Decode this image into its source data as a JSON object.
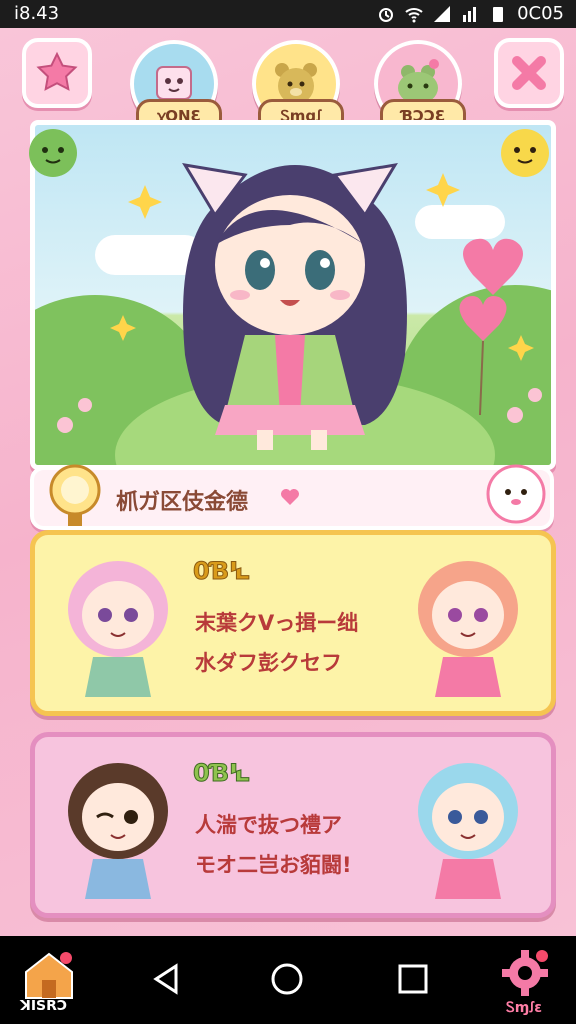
{
  "status_bar": {
    "time": "i8.43",
    "battery_text": "0C05"
  },
  "top_tabs": [
    {
      "label": "ꭓOƝƐ"
    },
    {
      "label": "Ꮪɱɑꭍ"
    },
    {
      "label": "ƁƆƆƐ"
    }
  ],
  "banner": {
    "text": "枛ガ区伎金德"
  },
  "cards": [
    {
      "tag": "0ƁꝆ",
      "line1": "末葉クVっ揖ー绌",
      "line2": "水ダフ彭クセフ"
    },
    {
      "tag": "0ƁꝆ",
      "line1": "人湍で抜つ禮ア",
      "line2": "モオ二岂お貊闘!"
    }
  ],
  "bottom_nav": {
    "home_label": "ꓘꓲꓢꓣꓛ",
    "settings_label": "Ꮪɱꭍɛ"
  },
  "colors": {
    "accent_pink": "#f48fb1",
    "card_yellow": "#fdf3a8",
    "card_pink": "#f7c4de"
  }
}
